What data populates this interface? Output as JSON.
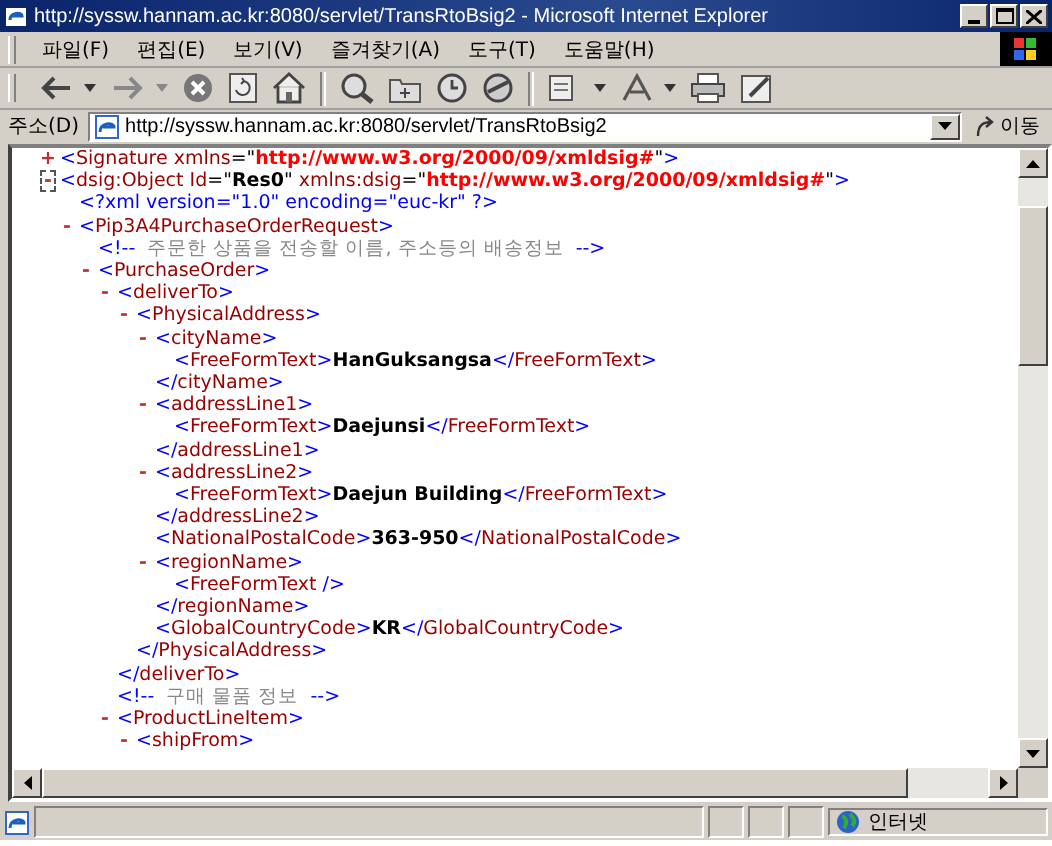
{
  "window": {
    "title": "http://syssw.hannam.ac.kr:8080/servlet/TransRtoBsig2 - Microsoft Internet Explorer"
  },
  "menu": [
    "파일(F)",
    "편집(E)",
    "보기(V)",
    "즐겨찾기(A)",
    "도구(T)",
    "도움말(H)"
  ],
  "address_bar": {
    "label": "주소(D)",
    "value": "http://syssw.hannam.ac.kr:8080/servlet/TransRtoBsig2",
    "go": "이동"
  },
  "xml": [
    {
      "toggle": "+",
      "focused": false,
      "segments": [
        {
          "kind": "p",
          "text": "<"
        },
        {
          "kind": "n",
          "text": "Signature"
        },
        {
          "kind": "a",
          "text": " xmlns"
        },
        {
          "kind": "q",
          "text": "=\""
        },
        {
          "kind": "ns",
          "text": "http://www.w3.org/2000/09/xmldsig#"
        },
        {
          "kind": "q",
          "text": "\""
        },
        {
          "kind": "p",
          "text": ">"
        }
      ]
    },
    {
      "toggle": "-",
      "focused": true,
      "segments": [
        {
          "kind": "p",
          "text": "<"
        },
        {
          "kind": "n",
          "text": "dsig:Object"
        },
        {
          "kind": "a",
          "text": " Id"
        },
        {
          "kind": "q",
          "text": "=\""
        },
        {
          "kind": "v",
          "text": "Res0"
        },
        {
          "kind": "q",
          "text": "\""
        },
        {
          "kind": "a",
          "text": " xmlns:dsig"
        },
        {
          "kind": "q",
          "text": "=\""
        },
        {
          "kind": "ns",
          "text": "http://www.w3.org/2000/09/xmldsig#"
        },
        {
          "kind": "q",
          "text": "\""
        },
        {
          "kind": "p",
          "text": ">"
        }
      ],
      "children": [
        {
          "segments": [
            {
              "kind": "p",
              "text": "<?xml version=\"1.0\" encoding=\"euc-kr\" ?>"
            }
          ]
        },
        {
          "toggle": "-",
          "focused": false,
          "segments": [
            {
              "kind": "p",
              "text": "<"
            },
            {
              "kind": "n",
              "text": "Pip3A4PurchaseOrderRequest"
            },
            {
              "kind": "p",
              "text": ">"
            }
          ],
          "children": [
            {
              "segments": [
                {
                  "kind": "p",
                  "text": "<!--"
                },
                {
                  "kind": "c",
                  "text": "  주문한 상품을 전송할 이름, 주소등의 배송정보  "
                },
                {
                  "kind": "p",
                  "text": "-->"
                }
              ]
            },
            {
              "toggle": "-",
              "focused": false,
              "segments": [
                {
                  "kind": "p",
                  "text": "<"
                },
                {
                  "kind": "n",
                  "text": "PurchaseOrder"
                },
                {
                  "kind": "p",
                  "text": ">"
                }
              ],
              "children": [
                {
                  "toggle": "-",
                  "focused": false,
                  "segments": [
                    {
                      "kind": "p",
                      "text": "<"
                    },
                    {
                      "kind": "n",
                      "text": "deliverTo"
                    },
                    {
                      "kind": "p",
                      "text": ">"
                    }
                  ],
                  "children": [
                    {
                      "toggle": "-",
                      "focused": false,
                      "segments": [
                        {
                          "kind": "p",
                          "text": "<"
                        },
                        {
                          "kind": "n",
                          "text": "PhysicalAddress"
                        },
                        {
                          "kind": "p",
                          "text": ">"
                        }
                      ],
                      "children": [
                        {
                          "toggle": "-",
                          "focused": false,
                          "segments": [
                            {
                              "kind": "p",
                              "text": "<"
                            },
                            {
                              "kind": "n",
                              "text": "cityName"
                            },
                            {
                              "kind": "p",
                              "text": ">"
                            }
                          ],
                          "children": [
                            {
                              "segments": [
                                {
                                  "kind": "p",
                                  "text": "<"
                                },
                                {
                                  "kind": "n",
                                  "text": "FreeFormText"
                                },
                                {
                                  "kind": "p",
                                  "text": ">"
                                },
                                {
                                  "kind": "t",
                                  "text": "HanGuksangsa"
                                },
                                {
                                  "kind": "p",
                                  "text": "</"
                                },
                                {
                                  "kind": "n",
                                  "text": "FreeFormText"
                                },
                                {
                                  "kind": "p",
                                  "text": ">"
                                }
                              ]
                            }
                          ]
                        },
                        {
                          "segments": [
                            {
                              "kind": "p",
                              "text": "</"
                            },
                            {
                              "kind": "n",
                              "text": "cityName"
                            },
                            {
                              "kind": "p",
                              "text": ">"
                            }
                          ]
                        },
                        {
                          "toggle": "-",
                          "focused": false,
                          "segments": [
                            {
                              "kind": "p",
                              "text": "<"
                            },
                            {
                              "kind": "n",
                              "text": "addressLine1"
                            },
                            {
                              "kind": "p",
                              "text": ">"
                            }
                          ],
                          "children": [
                            {
                              "segments": [
                                {
                                  "kind": "p",
                                  "text": "<"
                                },
                                {
                                  "kind": "n",
                                  "text": "FreeFormText"
                                },
                                {
                                  "kind": "p",
                                  "text": ">"
                                },
                                {
                                  "kind": "t",
                                  "text": "Daejunsi"
                                },
                                {
                                  "kind": "p",
                                  "text": "</"
                                },
                                {
                                  "kind": "n",
                                  "text": "FreeFormText"
                                },
                                {
                                  "kind": "p",
                                  "text": ">"
                                }
                              ]
                            }
                          ]
                        },
                        {
                          "segments": [
                            {
                              "kind": "p",
                              "text": "</"
                            },
                            {
                              "kind": "n",
                              "text": "addressLine1"
                            },
                            {
                              "kind": "p",
                              "text": ">"
                            }
                          ]
                        },
                        {
                          "toggle": "-",
                          "focused": false,
                          "segments": [
                            {
                              "kind": "p",
                              "text": "<"
                            },
                            {
                              "kind": "n",
                              "text": "addressLine2"
                            },
                            {
                              "kind": "p",
                              "text": ">"
                            }
                          ],
                          "children": [
                            {
                              "segments": [
                                {
                                  "kind": "p",
                                  "text": "<"
                                },
                                {
                                  "kind": "n",
                                  "text": "FreeFormText"
                                },
                                {
                                  "kind": "p",
                                  "text": ">"
                                },
                                {
                                  "kind": "t",
                                  "text": "Daejun Building"
                                },
                                {
                                  "kind": "p",
                                  "text": "</"
                                },
                                {
                                  "kind": "n",
                                  "text": "FreeFormText"
                                },
                                {
                                  "kind": "p",
                                  "text": ">"
                                }
                              ]
                            }
                          ]
                        },
                        {
                          "segments": [
                            {
                              "kind": "p",
                              "text": "</"
                            },
                            {
                              "kind": "n",
                              "text": "addressLine2"
                            },
                            {
                              "kind": "p",
                              "text": ">"
                            }
                          ]
                        },
                        {
                          "segments": [
                            {
                              "kind": "p",
                              "text": "<"
                            },
                            {
                              "kind": "n",
                              "text": "NationalPostalCode"
                            },
                            {
                              "kind": "p",
                              "text": ">"
                            },
                            {
                              "kind": "t",
                              "text": "363-950"
                            },
                            {
                              "kind": "p",
                              "text": "</"
                            },
                            {
                              "kind": "n",
                              "text": "NationalPostalCode"
                            },
                            {
                              "kind": "p",
                              "text": ">"
                            }
                          ]
                        },
                        {
                          "toggle": "-",
                          "focused": false,
                          "segments": [
                            {
                              "kind": "p",
                              "text": "<"
                            },
                            {
                              "kind": "n",
                              "text": "regionName"
                            },
                            {
                              "kind": "p",
                              "text": ">"
                            }
                          ],
                          "children": [
                            {
                              "segments": [
                                {
                                  "kind": "p",
                                  "text": "<"
                                },
                                {
                                  "kind": "n",
                                  "text": "FreeFormText"
                                },
                                {
                                  "kind": "p",
                                  "text": " />"
                                }
                              ]
                            }
                          ]
                        },
                        {
                          "segments": [
                            {
                              "kind": "p",
                              "text": "</"
                            },
                            {
                              "kind": "n",
                              "text": "regionName"
                            },
                            {
                              "kind": "p",
                              "text": ">"
                            }
                          ]
                        },
                        {
                          "segments": [
                            {
                              "kind": "p",
                              "text": "<"
                            },
                            {
                              "kind": "n",
                              "text": "GlobalCountryCode"
                            },
                            {
                              "kind": "p",
                              "text": ">"
                            },
                            {
                              "kind": "t",
                              "text": "KR"
                            },
                            {
                              "kind": "p",
                              "text": "</"
                            },
                            {
                              "kind": "n",
                              "text": "GlobalCountryCode"
                            },
                            {
                              "kind": "p",
                              "text": ">"
                            }
                          ]
                        }
                      ]
                    },
                    {
                      "segments": [
                        {
                          "kind": "p",
                          "text": "</"
                        },
                        {
                          "kind": "n",
                          "text": "PhysicalAddress"
                        },
                        {
                          "kind": "p",
                          "text": ">"
                        }
                      ]
                    }
                  ]
                },
                {
                  "segments": [
                    {
                      "kind": "p",
                      "text": "</"
                    },
                    {
                      "kind": "n",
                      "text": "deliverTo"
                    },
                    {
                      "kind": "p",
                      "text": ">"
                    }
                  ]
                },
                {
                  "segments": [
                    {
                      "kind": "p",
                      "text": "<!--"
                    },
                    {
                      "kind": "c",
                      "text": "  구매 물품 정보  "
                    },
                    {
                      "kind": "p",
                      "text": "-->"
                    }
                  ]
                },
                {
                  "toggle": "-",
                  "focused": false,
                  "segments": [
                    {
                      "kind": "p",
                      "text": "<"
                    },
                    {
                      "kind": "n",
                      "text": "ProductLineItem"
                    },
                    {
                      "kind": "p",
                      "text": ">"
                    }
                  ],
                  "children": [
                    {
                      "toggle": "-",
                      "focused": false,
                      "segments": [
                        {
                          "kind": "p",
                          "text": "<"
                        },
                        {
                          "kind": "n",
                          "text": "shipFrom"
                        },
                        {
                          "kind": "p",
                          "text": ">"
                        }
                      ]
                    }
                  ]
                }
              ]
            }
          ]
        }
      ]
    }
  ],
  "status_bar": {
    "zone": "인터넷"
  }
}
